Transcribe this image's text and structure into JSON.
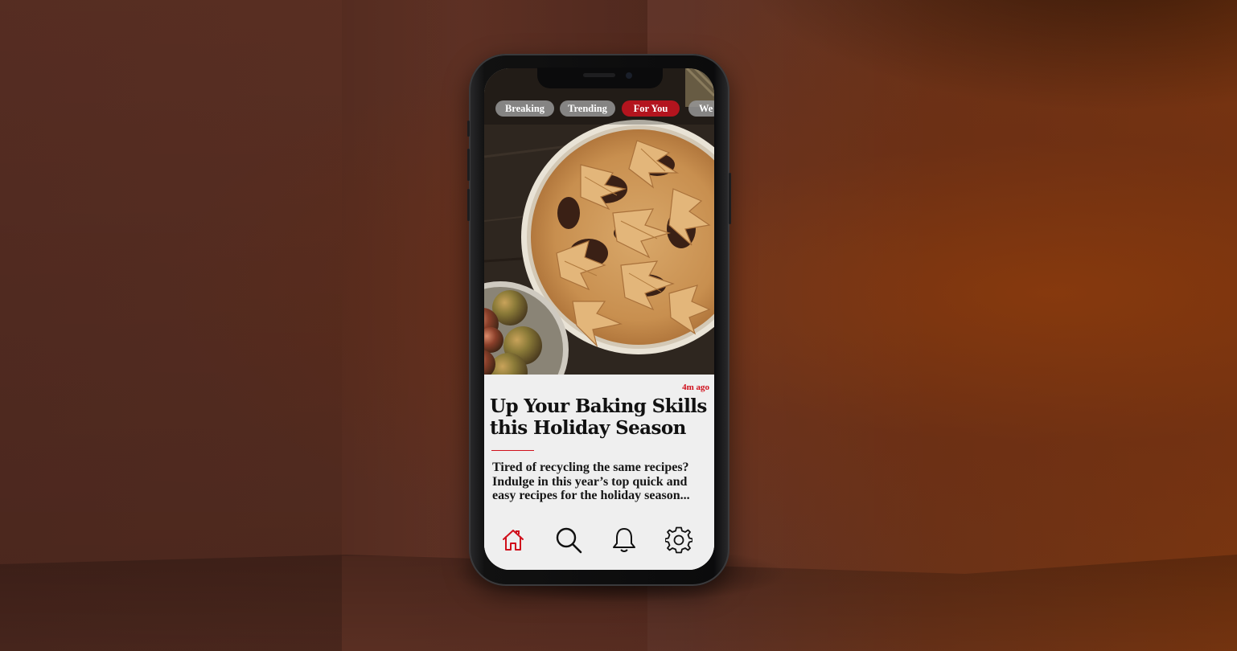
{
  "tabs": [
    {
      "label": "Breaking",
      "active": false
    },
    {
      "label": "Trending",
      "active": false
    },
    {
      "label": "For You",
      "active": true
    },
    {
      "label": "We",
      "active": false
    }
  ],
  "article": {
    "timestamp": "4m ago",
    "headline": "Up Your Baking Skills this Holiday Season",
    "summary": "Tired of recycling the same recipes? Indulge in this year’s top quick and easy recipes for the holiday season..."
  },
  "bottom_nav": [
    {
      "icon": "home-icon",
      "active": true
    },
    {
      "icon": "search-icon",
      "active": false
    },
    {
      "icon": "bell-icon",
      "active": false
    },
    {
      "icon": "gear-icon",
      "active": false
    }
  ],
  "colors": {
    "accent": "#d0101c",
    "active_tab": "#b3141e",
    "inactive_tab": "#969696",
    "article_bg": "#efefef"
  }
}
